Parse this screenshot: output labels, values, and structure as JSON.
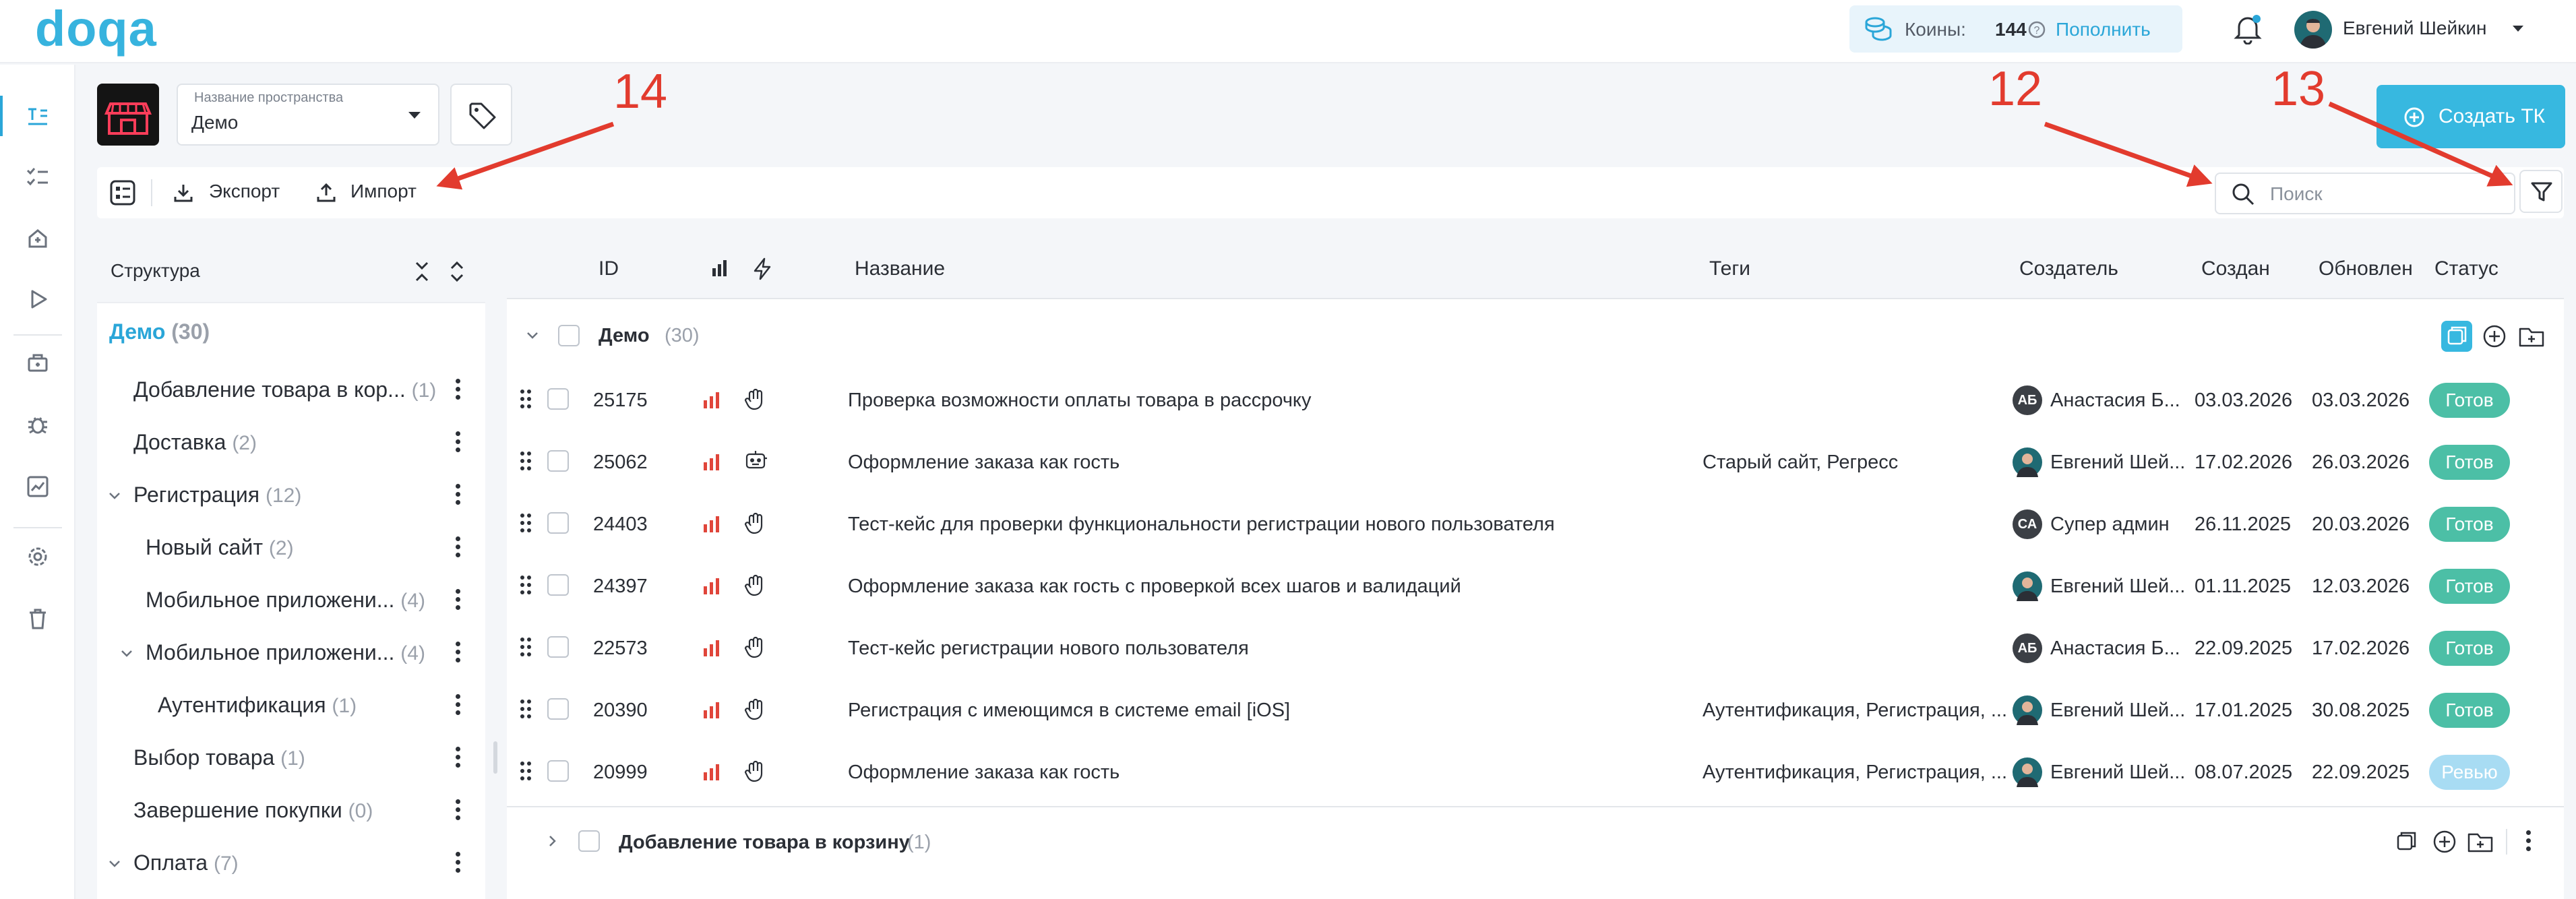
{
  "app": {
    "logo": "doqa"
  },
  "header": {
    "coins_label": "Коины:",
    "coins_value": "144",
    "topup_label": "Пополнить",
    "user_name": "Евгений Шейкин"
  },
  "space": {
    "caption": "Название пространства",
    "value": "Демо"
  },
  "create_button": "Создать ТК",
  "toolbar": {
    "export_label": "Экспорт",
    "import_label": "Импорт",
    "search_placeholder": "Поиск"
  },
  "annotations": [
    "14",
    "12",
    "13"
  ],
  "structure": {
    "title": "Структура",
    "root_name": "Демо",
    "root_count": "(30)",
    "items": [
      {
        "name": "Добавление товара в кор...",
        "count": "(1)"
      },
      {
        "name": "Доставка",
        "count": "(2)"
      },
      {
        "name": "Регистрация",
        "count": "(12)"
      },
      {
        "name": "Новый сайт",
        "count": "(2)"
      },
      {
        "name": "Мобильное приложени...",
        "count": "(4)"
      },
      {
        "name": "Мобильное приложени...",
        "count": "(4)"
      },
      {
        "name": "Аутентификация",
        "count": "(1)"
      },
      {
        "name": "Выбор товара",
        "count": "(1)"
      },
      {
        "name": "Завершение покупки",
        "count": "(0)"
      },
      {
        "name": "Оплата",
        "count": "(7)"
      }
    ]
  },
  "table": {
    "headers": {
      "id": "ID",
      "name": "Название",
      "tags": "Теги",
      "creator": "Создатель",
      "created": "Создан",
      "updated": "Обновлен",
      "status": "Статус"
    },
    "group": {
      "name": "Демо",
      "count": "(30)"
    },
    "rows": [
      {
        "id": "25175",
        "title": "Проверка возможности оплаты товара в рассрочку",
        "tags": "",
        "initials": "АБ",
        "creator": "Анастасия Б...",
        "created": "03.03.2026",
        "updated": "03.03.2026",
        "status": "Готов"
      },
      {
        "id": "25062",
        "title": "Оформление заказа как гость",
        "tags": "Старый сайт, Регресс",
        "initials": "",
        "creator": "Евгений Шей...",
        "created": "17.02.2026",
        "updated": "26.03.2026",
        "status": "Готов"
      },
      {
        "id": "24403",
        "title": "Тест-кейс для проверки функциональности регистрации нового пользователя",
        "tags": "",
        "initials": "СА",
        "creator": "Супер админ",
        "created": "26.11.2025",
        "updated": "20.03.2026",
        "status": "Готов"
      },
      {
        "id": "24397",
        "title": "Оформление заказа как гость с проверкой всех шагов и валидаций",
        "tags": "",
        "initials": "",
        "creator": "Евгений Шей...",
        "created": "01.11.2025",
        "updated": "12.03.2026",
        "status": "Готов"
      },
      {
        "id": "22573",
        "title": "Тест-кейс регистрации нового пользователя",
        "tags": "",
        "initials": "АБ",
        "creator": "Анастасия Б...",
        "created": "22.09.2025",
        "updated": "17.02.2026",
        "status": "Готов"
      },
      {
        "id": "20390",
        "title": "Регистрация с имеющимся в системе email [iOS]",
        "tags": "Аутентификация, Регистрация, ...",
        "initials": "",
        "creator": "Евгений Шей...",
        "created": "17.01.2025",
        "updated": "30.08.2025",
        "status": "Готов"
      },
      {
        "id": "20999",
        "title": "Оформление заказа как гость",
        "tags": "Аутентификация, Регистрация, ...",
        "initials": "",
        "creator": "Евгений Шей...",
        "created": "08.07.2025",
        "updated": "22.09.2025",
        "status": "Ревью"
      }
    ],
    "subgroup": {
      "name": "Добавление товара в корзину",
      "count": "(1)"
    }
  },
  "colors": {
    "accent": "#37b8e0",
    "ready": "#4cbfa6",
    "review": "#a8dcf3",
    "annotation": "#e23b2e",
    "priority": "#e0453a"
  }
}
